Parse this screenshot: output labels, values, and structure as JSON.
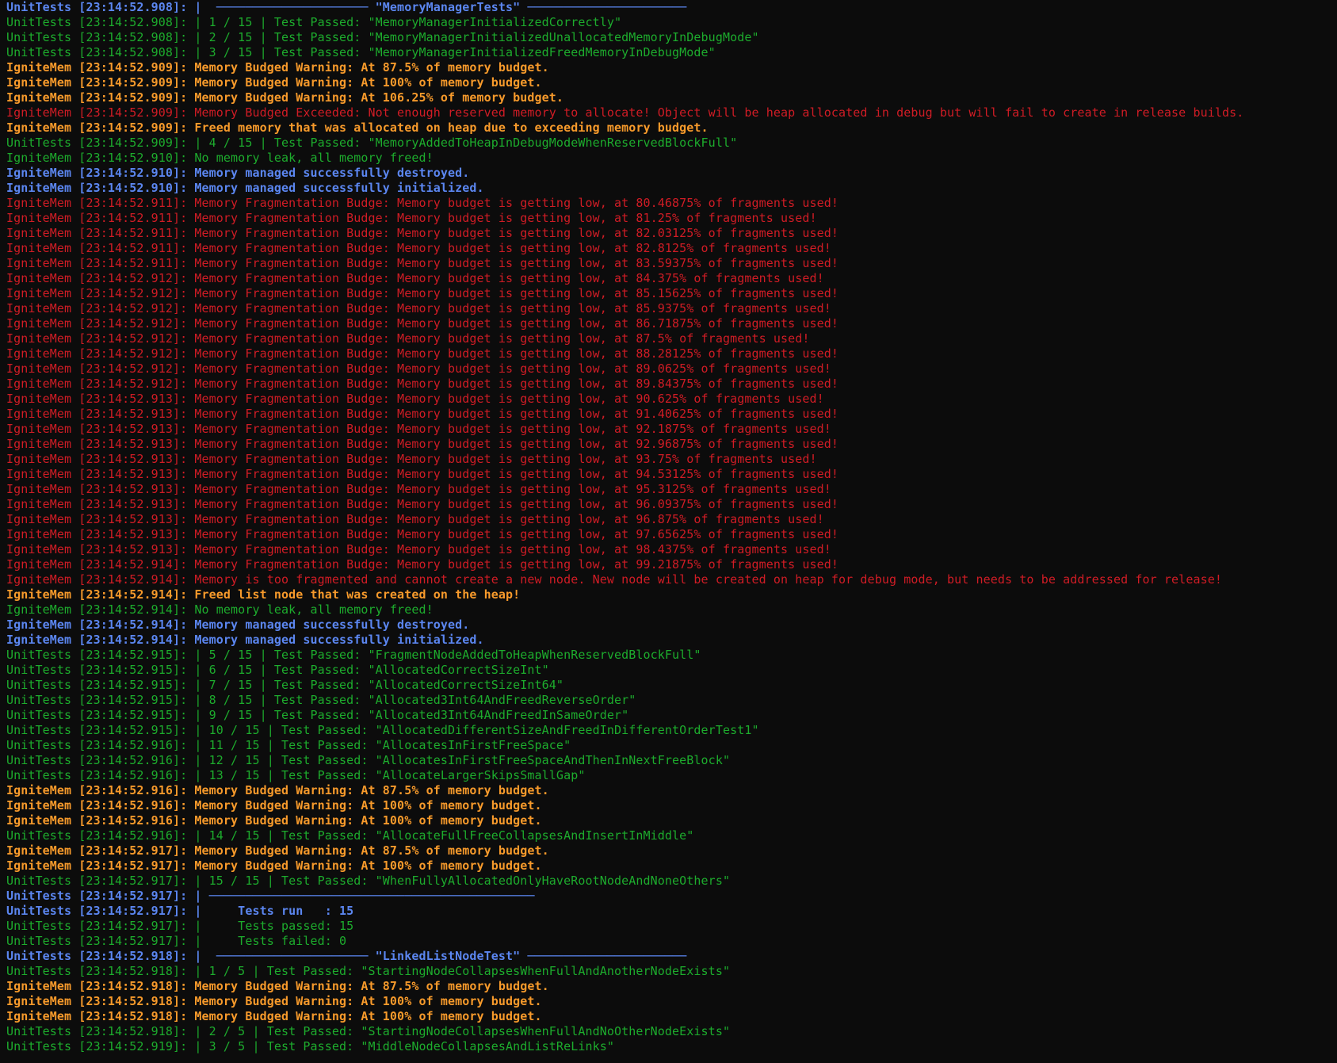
{
  "colors": {
    "blue": "#5b86f0",
    "green": "#1dac2d",
    "orange": "#f79a2b",
    "red": "#d01c25",
    "background": "#0c0c0c"
  },
  "lines": [
    {
      "color": "blue",
      "text": "UnitTests [23:14:52.908]: |  ───────────────────── \"MemoryManagerTests\" ──────────────────────"
    },
    {
      "color": "green",
      "text": "UnitTests [23:14:52.908]: | 1 / 15 | Test Passed: \"MemoryManagerInitializedCorrectly\""
    },
    {
      "color": "green",
      "text": "UnitTests [23:14:52.908]: | 2 / 15 | Test Passed: \"MemoryManagerInitializedUnallocatedMemoryInDebugMode\""
    },
    {
      "color": "green",
      "text": "UnitTests [23:14:52.908]: | 3 / 15 | Test Passed: \"MemoryManagerInitializedFreedMemoryInDebugMode\""
    },
    {
      "color": "orange",
      "text": "IgniteMem [23:14:52.909]: Memory Budged Warning: At 87.5% of memory budget."
    },
    {
      "color": "orange",
      "text": "IgniteMem [23:14:52.909]: Memory Budged Warning: At 100% of memory budget."
    },
    {
      "color": "orange",
      "text": "IgniteMem [23:14:52.909]: Memory Budged Warning: At 106.25% of memory budget."
    },
    {
      "color": "red",
      "text": "IgniteMem [23:14:52.909]: Memory Budged Exceeded: Not enough reserved memory to allocate! Object will be heap allocated in debug but will fail to create in release builds."
    },
    {
      "color": "orange",
      "text": "IgniteMem [23:14:52.909]: Freed memory that was allocated on heap due to exceeding memory budget."
    },
    {
      "color": "green",
      "text": "UnitTests [23:14:52.909]: | 4 / 15 | Test Passed: \"MemoryAddedToHeapInDebugModeWhenReservedBlockFull\""
    },
    {
      "color": "green",
      "text": "IgniteMem [23:14:52.910]: No memory leak, all memory freed!"
    },
    {
      "color": "blue",
      "text": "IgniteMem [23:14:52.910]: Memory managed successfully destroyed."
    },
    {
      "color": "blue",
      "text": "IgniteMem [23:14:52.910]: Memory managed successfully initialized."
    },
    {
      "color": "red",
      "text": "IgniteMem [23:14:52.911]: Memory Fragmentation Budge: Memory budget is getting low, at 80.46875% of fragments used!"
    },
    {
      "color": "red",
      "text": "IgniteMem [23:14:52.911]: Memory Fragmentation Budge: Memory budget is getting low, at 81.25% of fragments used!"
    },
    {
      "color": "red",
      "text": "IgniteMem [23:14:52.911]: Memory Fragmentation Budge: Memory budget is getting low, at 82.03125% of fragments used!"
    },
    {
      "color": "red",
      "text": "IgniteMem [23:14:52.911]: Memory Fragmentation Budge: Memory budget is getting low, at 82.8125% of fragments used!"
    },
    {
      "color": "red",
      "text": "IgniteMem [23:14:52.911]: Memory Fragmentation Budge: Memory budget is getting low, at 83.59375% of fragments used!"
    },
    {
      "color": "red",
      "text": "IgniteMem [23:14:52.912]: Memory Fragmentation Budge: Memory budget is getting low, at 84.375% of fragments used!"
    },
    {
      "color": "red",
      "text": "IgniteMem [23:14:52.912]: Memory Fragmentation Budge: Memory budget is getting low, at 85.15625% of fragments used!"
    },
    {
      "color": "red",
      "text": "IgniteMem [23:14:52.912]: Memory Fragmentation Budge: Memory budget is getting low, at 85.9375% of fragments used!"
    },
    {
      "color": "red",
      "text": "IgniteMem [23:14:52.912]: Memory Fragmentation Budge: Memory budget is getting low, at 86.71875% of fragments used!"
    },
    {
      "color": "red",
      "text": "IgniteMem [23:14:52.912]: Memory Fragmentation Budge: Memory budget is getting low, at 87.5% of fragments used!"
    },
    {
      "color": "red",
      "text": "IgniteMem [23:14:52.912]: Memory Fragmentation Budge: Memory budget is getting low, at 88.28125% of fragments used!"
    },
    {
      "color": "red",
      "text": "IgniteMem [23:14:52.912]: Memory Fragmentation Budge: Memory budget is getting low, at 89.0625% of fragments used!"
    },
    {
      "color": "red",
      "text": "IgniteMem [23:14:52.912]: Memory Fragmentation Budge: Memory budget is getting low, at 89.84375% of fragments used!"
    },
    {
      "color": "red",
      "text": "IgniteMem [23:14:52.913]: Memory Fragmentation Budge: Memory budget is getting low, at 90.625% of fragments used!"
    },
    {
      "color": "red",
      "text": "IgniteMem [23:14:52.913]: Memory Fragmentation Budge: Memory budget is getting low, at 91.40625% of fragments used!"
    },
    {
      "color": "red",
      "text": "IgniteMem [23:14:52.913]: Memory Fragmentation Budge: Memory budget is getting low, at 92.1875% of fragments used!"
    },
    {
      "color": "red",
      "text": "IgniteMem [23:14:52.913]: Memory Fragmentation Budge: Memory budget is getting low, at 92.96875% of fragments used!"
    },
    {
      "color": "red",
      "text": "IgniteMem [23:14:52.913]: Memory Fragmentation Budge: Memory budget is getting low, at 93.75% of fragments used!"
    },
    {
      "color": "red",
      "text": "IgniteMem [23:14:52.913]: Memory Fragmentation Budge: Memory budget is getting low, at 94.53125% of fragments used!"
    },
    {
      "color": "red",
      "text": "IgniteMem [23:14:52.913]: Memory Fragmentation Budge: Memory budget is getting low, at 95.3125% of fragments used!"
    },
    {
      "color": "red",
      "text": "IgniteMem [23:14:52.913]: Memory Fragmentation Budge: Memory budget is getting low, at 96.09375% of fragments used!"
    },
    {
      "color": "red",
      "text": "IgniteMem [23:14:52.913]: Memory Fragmentation Budge: Memory budget is getting low, at 96.875% of fragments used!"
    },
    {
      "color": "red",
      "text": "IgniteMem [23:14:52.913]: Memory Fragmentation Budge: Memory budget is getting low, at 97.65625% of fragments used!"
    },
    {
      "color": "red",
      "text": "IgniteMem [23:14:52.913]: Memory Fragmentation Budge: Memory budget is getting low, at 98.4375% of fragments used!"
    },
    {
      "color": "red",
      "text": "IgniteMem [23:14:52.914]: Memory Fragmentation Budge: Memory budget is getting low, at 99.21875% of fragments used!"
    },
    {
      "color": "red",
      "text": "IgniteMem [23:14:52.914]: Memory is too fragmented and cannot create a new node. New node will be created on heap for debug mode, but needs to be addressed for release!"
    },
    {
      "color": "orange",
      "text": "IgniteMem [23:14:52.914]: Freed list node that was created on the heap!"
    },
    {
      "color": "green",
      "text": "IgniteMem [23:14:52.914]: No memory leak, all memory freed!"
    },
    {
      "color": "blue",
      "text": "IgniteMem [23:14:52.914]: Memory managed successfully destroyed."
    },
    {
      "color": "blue",
      "text": "IgniteMem [23:14:52.914]: Memory managed successfully initialized."
    },
    {
      "color": "green",
      "text": "UnitTests [23:14:52.915]: | 5 / 15 | Test Passed: \"FragmentNodeAddedToHeapWhenReservedBlockFull\""
    },
    {
      "color": "green",
      "text": "UnitTests [23:14:52.915]: | 6 / 15 | Test Passed: \"AllocatedCorrectSizeInt\""
    },
    {
      "color": "green",
      "text": "UnitTests [23:14:52.915]: | 7 / 15 | Test Passed: \"AllocatedCorrectSizeInt64\""
    },
    {
      "color": "green",
      "text": "UnitTests [23:14:52.915]: | 8 / 15 | Test Passed: \"Allocated3Int64AndFreedReverseOrder\""
    },
    {
      "color": "green",
      "text": "UnitTests [23:14:52.915]: | 9 / 15 | Test Passed: \"Allocated3Int64AndFreedInSameOrder\""
    },
    {
      "color": "green",
      "text": "UnitTests [23:14:52.915]: | 10 / 15 | Test Passed: \"AllocatedDifferentSizeAndFreedInDifferentOrderTest1\""
    },
    {
      "color": "green",
      "text": "UnitTests [23:14:52.916]: | 11 / 15 | Test Passed: \"AllocatesInFirstFreeSpace\""
    },
    {
      "color": "green",
      "text": "UnitTests [23:14:52.916]: | 12 / 15 | Test Passed: \"AllocatesInFirstFreeSpaceAndThenInNextFreeBlock\""
    },
    {
      "color": "green",
      "text": "UnitTests [23:14:52.916]: | 13 / 15 | Test Passed: \"AllocateLargerSkipsSmallGap\""
    },
    {
      "color": "orange",
      "text": "IgniteMem [23:14:52.916]: Memory Budged Warning: At 87.5% of memory budget."
    },
    {
      "color": "orange",
      "text": "IgniteMem [23:14:52.916]: Memory Budged Warning: At 100% of memory budget."
    },
    {
      "color": "orange",
      "text": "IgniteMem [23:14:52.916]: Memory Budged Warning: At 100% of memory budget."
    },
    {
      "color": "green",
      "text": "UnitTests [23:14:52.916]: | 14 / 15 | Test Passed: \"AllocateFullFreeCollapsesAndInsertInMiddle\""
    },
    {
      "color": "orange",
      "text": "IgniteMem [23:14:52.917]: Memory Budged Warning: At 87.5% of memory budget."
    },
    {
      "color": "orange",
      "text": "IgniteMem [23:14:52.917]: Memory Budged Warning: At 100% of memory budget."
    },
    {
      "color": "green",
      "text": "UnitTests [23:14:52.917]: | 15 / 15 | Test Passed: \"WhenFullyAllocatedOnlyHaveRootNodeAndNoneOthers\""
    },
    {
      "color": "blue",
      "text": "UnitTests [23:14:52.917]: | ─────────────────────────────────────────────"
    },
    {
      "color": "blue",
      "text": "UnitTests [23:14:52.917]: |     Tests run   : 15"
    },
    {
      "color": "green",
      "text": "UnitTests [23:14:52.917]: |     Tests passed: 15"
    },
    {
      "color": "green",
      "text": "UnitTests [23:14:52.917]: |     Tests failed: 0"
    },
    {
      "color": "blue",
      "text": "UnitTests [23:14:52.918]: |  ───────────────────── \"LinkedListNodeTest\" ──────────────────────"
    },
    {
      "color": "green",
      "text": "UnitTests [23:14:52.918]: | 1 / 5 | Test Passed: \"StartingNodeCollapsesWhenFullAndAnotherNodeExists\""
    },
    {
      "color": "orange",
      "text": "IgniteMem [23:14:52.918]: Memory Budged Warning: At 87.5% of memory budget."
    },
    {
      "color": "orange",
      "text": "IgniteMem [23:14:52.918]: Memory Budged Warning: At 100% of memory budget."
    },
    {
      "color": "orange",
      "text": "IgniteMem [23:14:52.918]: Memory Budged Warning: At 100% of memory budget."
    },
    {
      "color": "green",
      "text": "UnitTests [23:14:52.918]: | 2 / 5 | Test Passed: \"StartingNodeCollapsesWhenFullAndNoOtherNodeExists\""
    },
    {
      "color": "green",
      "text": "UnitTests [23:14:52.919]: | 3 / 5 | Test Passed: \"MiddleNodeCollapsesAndListReLinks\""
    }
  ]
}
